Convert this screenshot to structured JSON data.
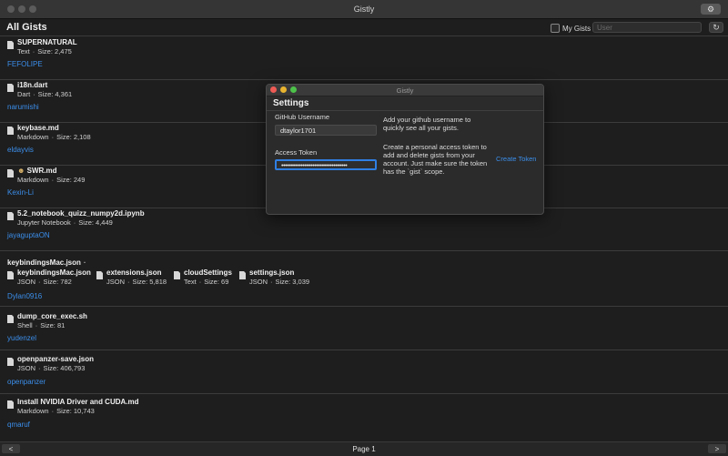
{
  "window": {
    "title": "Gistly"
  },
  "toolbar": {
    "page_title": "All Gists",
    "my_gists_label": "My Gists",
    "user_placeholder": "User",
    "settings_icon": "gear-icon",
    "refresh_icon": "refresh-icon"
  },
  "gists": [
    {
      "files": [
        {
          "name": "SUPERNATURAL",
          "type": "Text",
          "size": "Size: 2,475"
        }
      ],
      "owner": "FEFOLIPE"
    },
    {
      "files": [
        {
          "name": "i18n.dart",
          "type": "Dart",
          "size": "Size: 4,361"
        }
      ],
      "owner": "narumishi"
    },
    {
      "files": [
        {
          "name": "keybase.md",
          "type": "Markdown",
          "size": "Size: 2,108"
        }
      ],
      "owner": "eldayvis"
    },
    {
      "files": [
        {
          "name": "SWR.md",
          "type": "Markdown",
          "size": "Size: 249"
        }
      ],
      "owner": "Kexin-Li"
    },
    {
      "files": [
        {
          "name": "5.2_notebook_quizz_numpy2d.ipynb",
          "type": "Jupyter Notebook",
          "size": "Size: 4,449"
        }
      ],
      "owner": "jayaguptaON"
    },
    {
      "title": "keybindingsMac.json",
      "files": [
        {
          "name": "keybindingsMac.json",
          "type": "JSON",
          "size": "Size: 782"
        },
        {
          "name": "extensions.json",
          "type": "JSON",
          "size": "Size: 5,818"
        },
        {
          "name": "cloudSettings",
          "type": "Text",
          "size": "Size: 69"
        },
        {
          "name": "settings.json",
          "type": "JSON",
          "size": "Size: 3,039"
        }
      ],
      "owner": "Dylan0916"
    },
    {
      "files": [
        {
          "name": "dump_core_exec.sh",
          "type": "Shell",
          "size": "Size: 81"
        }
      ],
      "owner": "yudenzel"
    },
    {
      "files": [
        {
          "name": "openpanzer-save.json",
          "type": "JSON",
          "size": "Size: 406,793"
        }
      ],
      "owner": "openpanzer"
    },
    {
      "files": [
        {
          "name": "Install NVIDIA Driver and CUDA.md",
          "type": "Markdown",
          "size": "Size: 10,743"
        }
      ],
      "owner": "qmaruf"
    }
  ],
  "footer": {
    "page_label": "Page 1",
    "prev": "<",
    "next": ">"
  },
  "settings": {
    "window_title": "Gistly",
    "heading": "Settings",
    "username_label": "GitHub Username",
    "username_value": "dtaylor1701",
    "username_help": "Add your github username to quickly see all your gists.",
    "token_label": "Access Token",
    "token_value": "••••••••••••••••••••••••••••••••••",
    "token_help": "Create a personal access token to add and delete gists from your account. Just make sure the token has the `gist` scope.",
    "create_token_link": "Create Token"
  },
  "colors": {
    "accent": "#3b8eea",
    "background": "#1e1e1e",
    "focus_ring": "#2f7fe3"
  }
}
